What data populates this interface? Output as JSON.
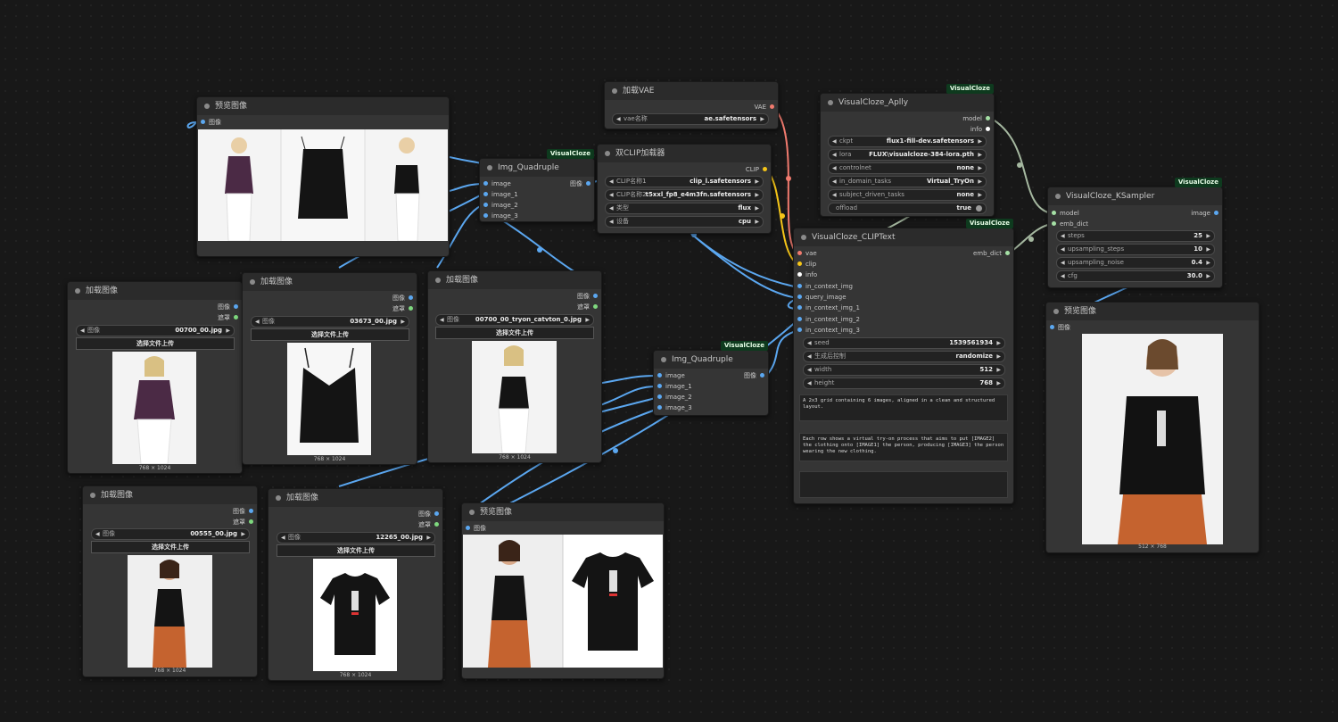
{
  "colors": {
    "link_image": "#5ba7f0",
    "link_vae": "#f07a6e",
    "link_clip": "#f5c518",
    "link_model": "#a5b8a0",
    "port_image": "#5ba7f0",
    "port_mask": "#7ed87e",
    "port_vae": "#f07a6e",
    "port_clip": "#f5c518",
    "port_model": "#a5e0a5",
    "badge_bg": "#0e3a1e",
    "node_bg": "#353535",
    "canvas_bg": "#181818"
  },
  "nodes": {
    "preview_top": {
      "title": "预览图像",
      "input": "图像"
    },
    "quad1": {
      "badge": "VisualCloze",
      "title": "Img_Quadruple",
      "inputs": [
        "image",
        "image_1",
        "image_2",
        "image_3"
      ],
      "output": "图像"
    },
    "quad2": {
      "badge": "VisualCloze",
      "title": "Img_Quadruple",
      "inputs": [
        "image",
        "image_1",
        "image_2",
        "image_3"
      ],
      "output": "图像"
    },
    "vae": {
      "title": "加载VAE",
      "output": "VAE",
      "widget_label": "vae名称",
      "widget_value": "ae.safetensors"
    },
    "dualclip": {
      "title": "双CLIP加载器",
      "output": "CLIP",
      "widgets": [
        {
          "label": "CLIP名称1",
          "value": "clip_l.safetensors"
        },
        {
          "label": "CLIP名称2",
          "value": "t5xxl_fp8_e4m3fn.safetensors"
        },
        {
          "label": "类型",
          "value": "flux"
        },
        {
          "label": "设备",
          "value": "cpu"
        }
      ]
    },
    "apply": {
      "badge": "VisualCloze",
      "title": "VisualCloze_Aplly",
      "outputs": [
        "model",
        "info"
      ],
      "widgets": [
        {
          "label": "ckpt",
          "value": "flux1-fill-dev.safetensors"
        },
        {
          "label": "lora",
          "value": "FLUX\\visualcloze-384-lora.pth"
        },
        {
          "label": "controlnet",
          "value": "none"
        },
        {
          "label": "in_domain_tasks",
          "value": "Virtual_TryOn"
        },
        {
          "label": "subject_driven_tasks",
          "value": "none"
        }
      ],
      "toggle_label": "offload",
      "toggle_value": "true"
    },
    "cliptext": {
      "badge": "VisualCloze",
      "title": "VisualCloze_CLIPText",
      "output": "emb_dict",
      "inputs": [
        "vae",
        "clip",
        "info",
        "in_context_img",
        "query_image",
        "in_context_img_1",
        "in_context_img_2",
        "in_context_img_3"
      ],
      "widgets": [
        {
          "label": "seed",
          "value": "1539561934"
        },
        {
          "label": "生成后控制",
          "value": "randomize"
        },
        {
          "label": "width",
          "value": "512"
        },
        {
          "label": "height",
          "value": "768"
        }
      ],
      "text1": "A 2x3 grid containing 6 images, aligned in a clean and structured layout.",
      "text2": "Each row shows a virtual try-on process that aims to put [IMAGE2] the clothing onto [IMAGE1] the person, producing [IMAGE3] the person wearing the new clothing.",
      "text3": ""
    },
    "ksampler": {
      "badge": "VisualCloze",
      "title": "VisualCloze_KSampler",
      "inputs": [
        "model",
        "emb_dict"
      ],
      "output": "image",
      "widgets": [
        {
          "label": "steps",
          "value": "25"
        },
        {
          "label": "upsampling_steps",
          "value": "10"
        },
        {
          "label": "upsampling_noise",
          "value": "0.4"
        },
        {
          "label": "cfg",
          "value": "30.0"
        }
      ]
    },
    "preview_right": {
      "title": "预览图像",
      "input": "图像",
      "caption": "512 × 768"
    },
    "load1": {
      "title": "加载图像",
      "outputs": [
        "图像",
        "遮罩"
      ],
      "widget_label": "图像",
      "widget_value": "00700_00.jpg",
      "button": "选择文件上传",
      "caption": "768 × 1024"
    },
    "load2": {
      "title": "加载图像",
      "outputs": [
        "图像",
        "遮罩"
      ],
      "widget_label": "图像",
      "widget_value": "03673_00.jpg",
      "button": "选择文件上传",
      "caption": "768 × 1024"
    },
    "load3": {
      "title": "加载图像",
      "outputs": [
        "图像",
        "遮罩"
      ],
      "widget_label": "图像",
      "widget_value": "00700_00_tryon_catvton_0.jpg",
      "button": "选择文件上传",
      "caption": "768 × 1024"
    },
    "load4": {
      "title": "加载图像",
      "outputs": [
        "图像",
        "遮罩"
      ],
      "widget_label": "图像",
      "widget_value": "00555_00.jpg",
      "button": "选择文件上传",
      "caption": "768 × 1024"
    },
    "load5": {
      "title": "加载图像",
      "outputs": [
        "图像",
        "遮罩"
      ],
      "widget_label": "图像",
      "widget_value": "12265_00.jpg",
      "button": "选择文件上传",
      "caption": "768 × 1024"
    },
    "preview_bottom": {
      "title": "预览图像",
      "input": "图像"
    }
  }
}
